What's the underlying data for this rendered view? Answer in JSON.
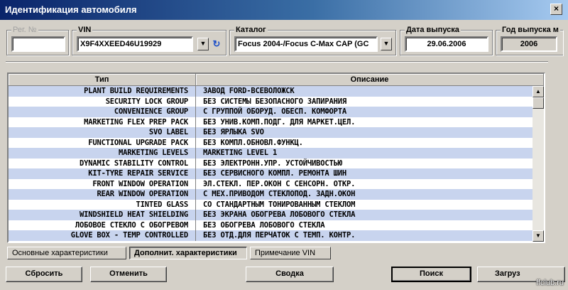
{
  "window": {
    "title": "Идентификация автомобиля",
    "close_glyph": "×"
  },
  "fields": {
    "reg": {
      "label": "Рег. №",
      "value": ""
    },
    "vin": {
      "label": "VIN",
      "value": "X9F4XXEED46U19929"
    },
    "catalog": {
      "label": "Каталог",
      "value": "Focus 2004-/Focus C-Max CAP (GC"
    },
    "release_date": {
      "label": "Дата выпуска",
      "value": "29.06.2006"
    },
    "release_year": {
      "label": "Год выпуска м",
      "value": "2006"
    }
  },
  "table": {
    "headers": {
      "type": "Тип",
      "description": "Описание"
    },
    "rows": [
      [
        "PLANT BUILD REQUIREMENTS",
        "ЗАВОД FORD-ВСЕВОЛОЖСК"
      ],
      [
        "SECURITY LOCK GROUP",
        "БЕЗ СИСТЕМЫ БЕЗОПАСНОГО ЗАПИРАНИЯ"
      ],
      [
        "CONVENIENCE GROUP",
        "С ГРУППОЙ ОБОРУД. ОБЕСП. КОМФОРТА"
      ],
      [
        "MARKETING FLEX PREP PACK",
        "БЕЗ УНИВ.КОМП.ПОДГ. ДЛЯ МАРКЕТ.ЦЕЛ."
      ],
      [
        "SVO LABEL",
        "БЕЗ ЯРЛЫКА SVO"
      ],
      [
        "FUNCTIONAL UPGRADE PACK",
        "БЕЗ КОМПЛ.ОБНОВЛ.ФУНКЦ."
      ],
      [
        "MARKETING LEVELS",
        "MARKETING LEVEL 1"
      ],
      [
        "DYNAMIC STABILITY CONTROL",
        "БЕЗ ЭЛЕКТРОНН.УПР. УСТОЙЧИВОСТЬЮ"
      ],
      [
        "KIT-TYRE REPAIR SERVICE",
        "БЕЗ СЕРВИСНОГО КОМПЛ. РЕМОНТА ШИН"
      ],
      [
        "FRONT WINDOW OPERATION",
        "ЭЛ.СТЕКЛ. ПЕР.ОКОН С СЕНСОРН. ОТКР."
      ],
      [
        "REAR WINDOW OPERATION",
        "С МЕХ.ПРИВОДОМ СТЕКЛОПОД. ЗАДН.ОКОН"
      ],
      [
        "TINTED GLASS",
        "СО СТАНДАРТНЫМ ТОНИРОВАННЫМ СТЕКЛОМ"
      ],
      [
        "WINDSHIELD HEAT SHIELDING",
        "БЕЗ ЭКРАНА ОБОГРЕВА ЛОБОВОГО СТЕКЛА"
      ],
      [
        "ЛОБОВОЕ СТЕКЛО С ОБОГРЕВОМ",
        "БЕЗ ОБОГРЕВА ЛОБОВОГО СТЕКЛА"
      ],
      [
        "GLOVE BOX - TEMP CONTROLLED",
        "БЕЗ ОТД.ДЛЯ ПЕРЧАТОК С ТЕМП. КОНТР."
      ]
    ]
  },
  "tabs": [
    {
      "label": "Основные характеристики",
      "active": false
    },
    {
      "label": "Дополнит. характеристики",
      "active": true
    },
    {
      "label": "Примечание VIN",
      "active": false
    }
  ],
  "buttons": {
    "reset": "Сбросить",
    "cancel": "Отменить",
    "summary": "Сводка",
    "search": "Поиск",
    "load": "Загруз"
  },
  "watermark": "ffclub.ru"
}
